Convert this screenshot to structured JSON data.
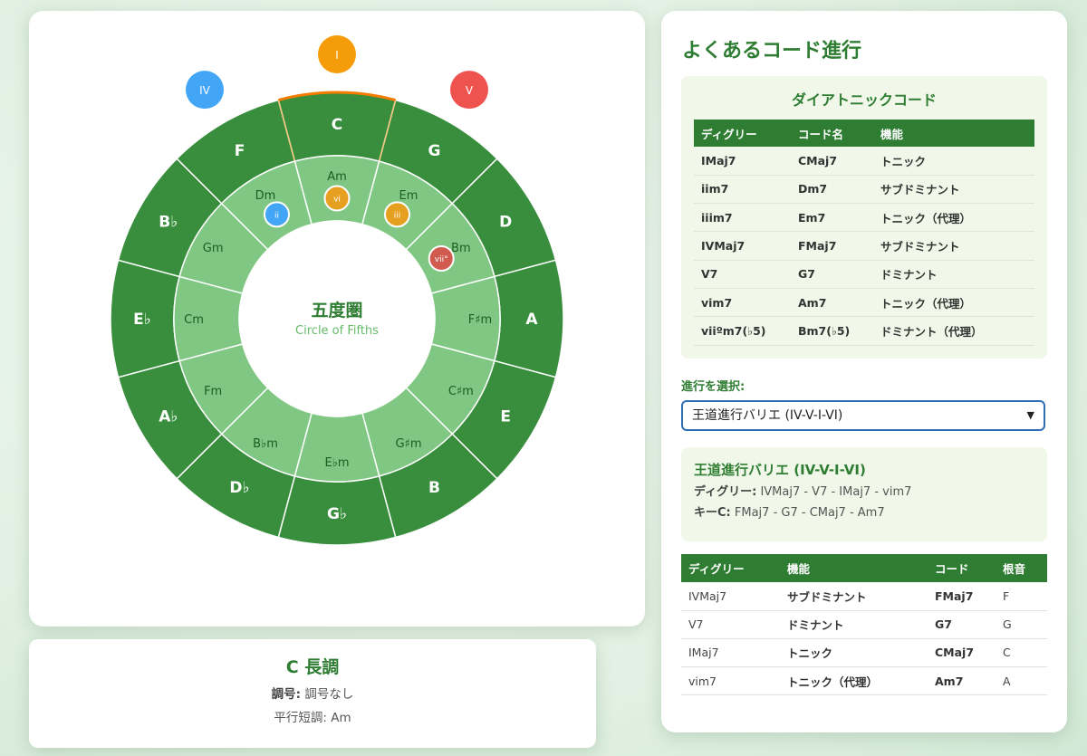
{
  "circle": {
    "title": "五度圏",
    "subtitle": "Circle of Fifths",
    "major_keys": [
      "C",
      "G",
      "D",
      "A",
      "E",
      "B",
      "G♭",
      "D♭",
      "A♭",
      "E♭",
      "B♭",
      "F"
    ],
    "minor_keys": [
      "Am",
      "Em",
      "Bm",
      "F♯m",
      "C♯m",
      "G♯m",
      "E♭m",
      "B♭m",
      "Fm",
      "Cm",
      "Gm",
      "Dm"
    ],
    "selected_key": "C",
    "outer_badges": [
      {
        "label": "IV",
        "key": "F",
        "color": "#42a5f5"
      },
      {
        "label": "I",
        "key": "C",
        "color": "#f59c0b"
      },
      {
        "label": "V",
        "key": "G",
        "color": "#ef5350"
      }
    ],
    "inner_badges": [
      {
        "label": "ii",
        "key": "Dm",
        "color": "#42a5f5"
      },
      {
        "label": "vi",
        "key": "Am",
        "color": "#e6a020"
      },
      {
        "label": "iii",
        "key": "Em",
        "color": "#e6a020"
      },
      {
        "label": "vii°",
        "key": "Bm",
        "color": "#d05a4e"
      }
    ],
    "colors": {
      "outer_ring": "#388e3c",
      "inner_ring": "#81c784",
      "center": "#ffffff",
      "highlight": "#f57c00"
    }
  },
  "key_info": {
    "title": "C 長調",
    "signature_label": "調号:",
    "signature_value": "調号なし",
    "relative_text": "平行短調: Am"
  },
  "right_panel": {
    "title": "よくあるコード進行",
    "diatonic": {
      "title": "ダイアトニックコード",
      "headers": [
        "ディグリー",
        "コード名",
        "機能"
      ],
      "rows": [
        [
          "IMaj7",
          "CMaj7",
          "トニック"
        ],
        [
          "iim7",
          "Dm7",
          "サブドミナント"
        ],
        [
          "iiim7",
          "Em7",
          "トニック（代理）"
        ],
        [
          "IVMaj7",
          "FMaj7",
          "サブドミナント"
        ],
        [
          "V7",
          "G7",
          "ドミナント"
        ],
        [
          "vim7",
          "Am7",
          "トニック（代理）"
        ],
        [
          "viiºm7(♭5)",
          "Bm7(♭5)",
          "ドミナント（代理）"
        ]
      ]
    },
    "select_label": "進行を選択:",
    "select_value": "王道進行バリエ (IV-V-I-VI)",
    "progression": {
      "title": "王道進行バリエ (IV-V-I-VI)",
      "degree_label": "ディグリー:",
      "degree_value": "IVMaj7 - V7 - IMaj7 - vim7",
      "key_label": "キーC:",
      "key_value": "FMaj7 - G7 - CMaj7 - Am7"
    },
    "progression_table": {
      "headers": [
        "ディグリー",
        "機能",
        "コード",
        "根音"
      ],
      "rows": [
        [
          "IVMaj7",
          "サブドミナント",
          "FMaj7",
          "F"
        ],
        [
          "V7",
          "ドミナント",
          "G7",
          "G"
        ],
        [
          "IMaj7",
          "トニック",
          "CMaj7",
          "C"
        ],
        [
          "vim7",
          "トニック（代理）",
          "Am7",
          "A"
        ]
      ]
    }
  }
}
